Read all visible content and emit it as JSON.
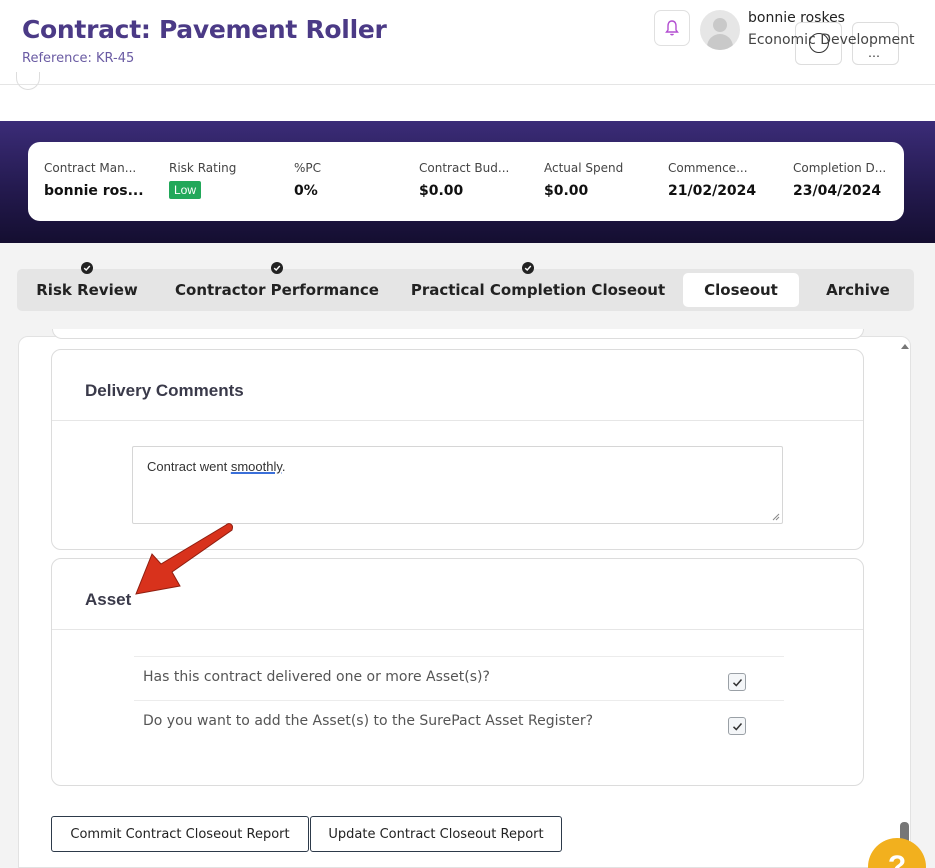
{
  "header": {
    "title": "Contract: Pavement Roller",
    "reference": "Reference: KR-45",
    "user_name": "bonnie roskes",
    "user_department": "Economic Development"
  },
  "summary": [
    {
      "label": "Contract Man...",
      "value": "bonnie ros..."
    },
    {
      "label": "Risk Rating",
      "value": "Low"
    },
    {
      "label": "%PC",
      "value": "0%"
    },
    {
      "label": "Contract Bud...",
      "value": "$0.00"
    },
    {
      "label": "Actual Spend",
      "value": "$0.00"
    },
    {
      "label": "Commence...",
      "value": "21/02/2024"
    },
    {
      "label": "Completion D...",
      "value": "23/04/2024"
    }
  ],
  "tabs": [
    {
      "label": "Risk Review",
      "completed": true
    },
    {
      "label": "Contractor Performance",
      "completed": true
    },
    {
      "label": "Practical Completion Closeout",
      "completed": true
    },
    {
      "label": "Closeout",
      "completed": false,
      "active": true
    },
    {
      "label": "Archive",
      "completed": false
    }
  ],
  "delivery_comments": {
    "title": "Delivery Comments",
    "text_before": "Contract went ",
    "text_underlined": "smoothly",
    "text_after": "."
  },
  "asset": {
    "title": "Asset",
    "questions": [
      {
        "text": "Has this contract delivered one or more Asset(s)?",
        "checked": true
      },
      {
        "text": "Do you want to add the Asset(s) to the SurePact Asset Register?",
        "checked": true
      }
    ]
  },
  "buttons": {
    "commit": "Commit Contract Closeout Report",
    "update": "Update Contract Closeout Report"
  },
  "help": {
    "label": "?"
  },
  "colors": {
    "title": "#4b3a86",
    "banner": "#241a4f",
    "risk_low": "#22a85a",
    "help": "#f2b01e",
    "annotation_arrow": "#d8321c"
  }
}
